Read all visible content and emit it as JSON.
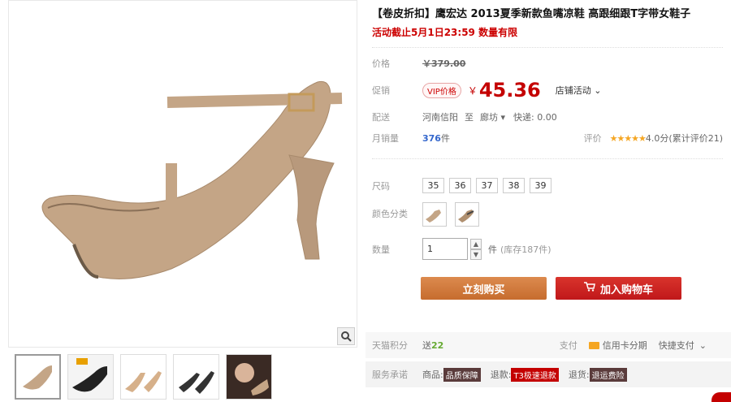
{
  "product": {
    "title": "【卷皮折扣】鹰宏达 2013夏季新款鱼嘴凉鞋 高跟细跟T字带女鞋子",
    "promo": "活动截止5月1日23:59 数量有限"
  },
  "price": {
    "label": "价格",
    "value": "￥379.00"
  },
  "promo_price": {
    "label": "促销",
    "vip": "VIP价格",
    "currency": "￥",
    "value": "45.36",
    "store_activity": "店铺活动"
  },
  "shipping": {
    "label": "配送",
    "from": "河南信阳",
    "to_word": "至",
    "to": "廊坊",
    "express": "快递: 0.00"
  },
  "monthly_sales": {
    "label": "月销量",
    "count": "376",
    "unit": "件",
    "rating_label": "评价",
    "stars": "★★★★★",
    "score": "4.0分",
    "review_count": "(累计评价21)"
  },
  "size": {
    "label": "尺码",
    "options": [
      "35",
      "36",
      "37",
      "38",
      "39"
    ]
  },
  "color": {
    "label": "颜色分类"
  },
  "quantity": {
    "label": "数量",
    "value": "1",
    "unit": "件",
    "stock": "(库存187件)"
  },
  "buttons": {
    "buy_now": "立刻购买",
    "add_cart": "加入购物车"
  },
  "points": {
    "label": "天猫积分",
    "give": "送",
    "value": "22",
    "pay_label": "支付",
    "credit": "信用卡分期",
    "quick_pay": "快捷支付"
  },
  "service": {
    "label": "服务承诺",
    "goods": "商品:",
    "goods_tag": "品质保障",
    "refund": "退款:",
    "refund_tag": "T3极速退款",
    "ship": "退货:",
    "ship_tag": "退运费险"
  },
  "colors": {
    "accent": "#c40000",
    "buy": "#c66c2e",
    "sales": "#3366cc"
  }
}
